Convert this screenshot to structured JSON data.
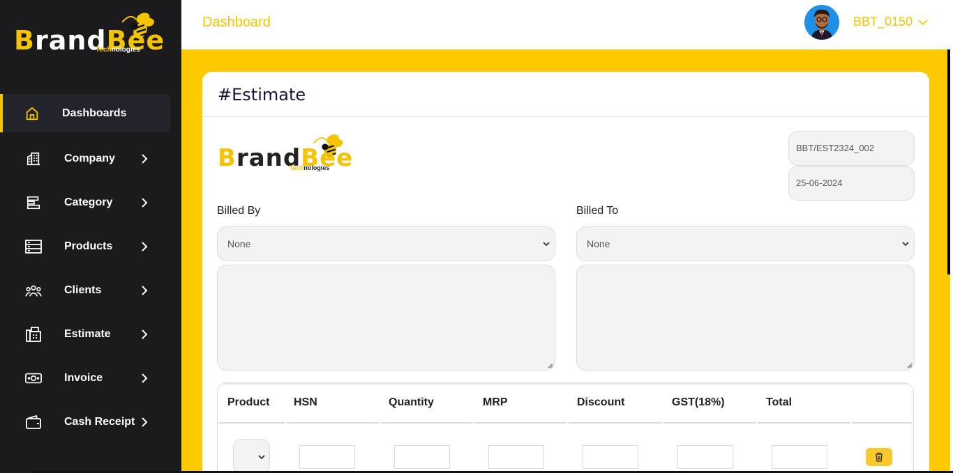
{
  "brand": {
    "part1": "B",
    "part2": "rand",
    "part3": "Bee",
    "sub1": "Tech",
    "sub2": "nologies"
  },
  "sidebar": {
    "items": [
      {
        "label": "Dashboards",
        "icon": "home-icon",
        "active": true
      },
      {
        "label": "Company",
        "icon": "building-icon"
      },
      {
        "label": "Category",
        "icon": "category-icon"
      },
      {
        "label": "Products",
        "icon": "products-icon"
      },
      {
        "label": "Clients",
        "icon": "clients-icon"
      },
      {
        "label": "Estimate",
        "icon": "fax-icon"
      },
      {
        "label": "Invoice",
        "icon": "cash-icon"
      },
      {
        "label": "Cash Receipt",
        "icon": "wallet-icon"
      }
    ]
  },
  "header": {
    "title": "Dashboard",
    "user": "BBT_0150"
  },
  "estimate": {
    "title": "#Estimate",
    "number": "BBT/EST2324_002",
    "date": "25-06-2024",
    "billed_by_label": "Billed By",
    "billed_to_label": "Billed To",
    "billed_by_value": "None",
    "billed_to_value": "None"
  },
  "table": {
    "headers": [
      "Product",
      "HSN",
      "Quantity",
      "MRP",
      "Discount",
      "GST(18%)",
      "Total"
    ]
  },
  "colors": {
    "accent": "#fdca00",
    "sidebar": "#1b1b1d",
    "title": "#15153a"
  }
}
